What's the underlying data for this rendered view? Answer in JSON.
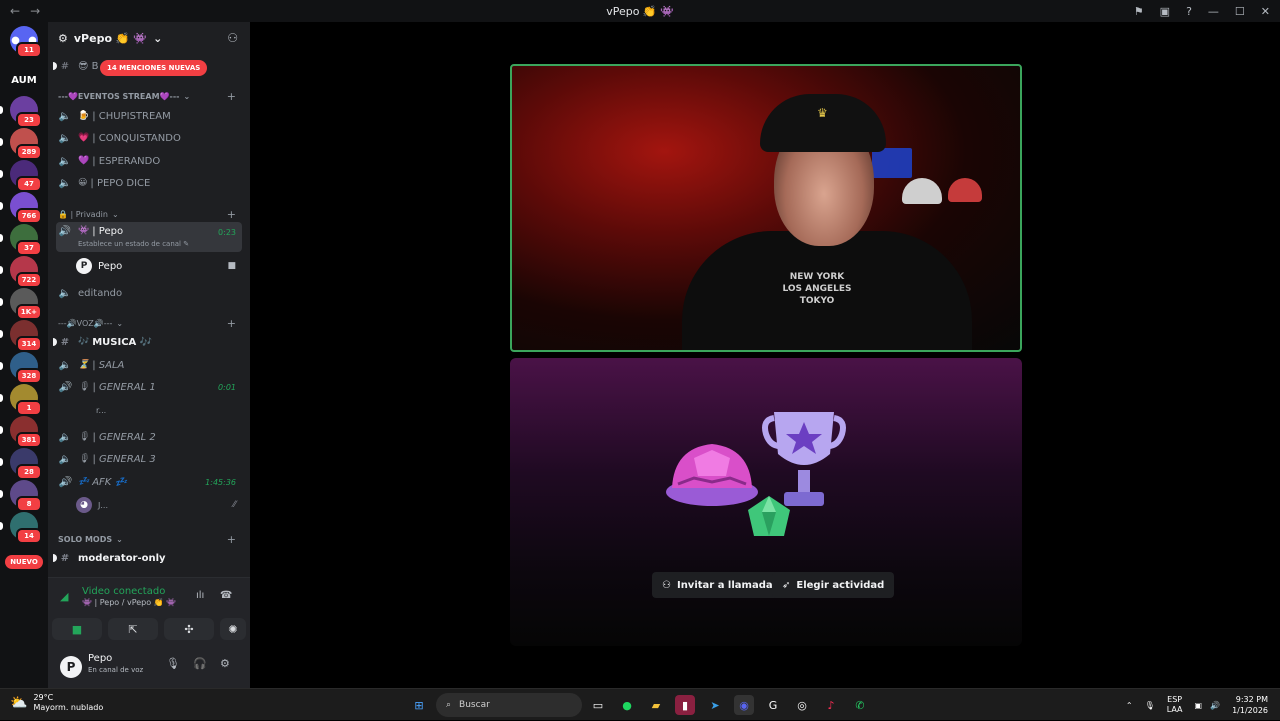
{
  "window": {
    "title": "vPepo 👏 👾",
    "back": "←",
    "forward": "→"
  },
  "rail": {
    "home_badge": "11",
    "aum_label": "AUM",
    "servers": [
      {
        "badge": "23",
        "color": "#6b3fa0"
      },
      {
        "badge": "289",
        "color": "#c0504d"
      },
      {
        "badge": "47",
        "color": "#4b2a7a"
      },
      {
        "badge": "766",
        "color": "#7a4fd1"
      },
      {
        "badge": "37",
        "color": "#3d6e3d"
      },
      {
        "badge": "722",
        "color": "#b5374a"
      },
      {
        "badge": "1K+",
        "color": "#5a5a5a"
      },
      {
        "badge": "314",
        "color": "#7b2f2f"
      },
      {
        "badge": "328",
        "color": "#2f5f8a"
      },
      {
        "badge": "1",
        "color": "#a38a2f"
      },
      {
        "badge": "381",
        "color": "#8a2f2f"
      },
      {
        "badge": "28",
        "color": "#3a3a6a"
      },
      {
        "badge": "8",
        "color": "#5e4a8a"
      },
      {
        "badge": "14",
        "color": "#2f6f6f"
      }
    ],
    "nuevo": "NUEVO"
  },
  "server": {
    "name": "vPepo 👏 👾",
    "mentions": "14 MENCIONES NUEVAS",
    "top_channel_prefix": "😎 B"
  },
  "categories": {
    "eventos": "---💜EVENTOS STREAM💜---",
    "privadin": "🔒 | Privadin",
    "voz": "---🔊VOZ🔊---",
    "solo_mods": "SOLO MODS"
  },
  "channels": {
    "chupistream": {
      "emoji": "🍺",
      "name": "| CHUPISTREAM"
    },
    "conquistando": {
      "emoji": "💗",
      "name": "| CONQUISTANDO"
    },
    "esperando": {
      "emoji": "💜",
      "name": "| ESPERANDO"
    },
    "pepo_dice": {
      "emoji": "😀",
      "name": "| PEPO DICE"
    },
    "pepo": {
      "emoji": "👾",
      "name": "| Pepo",
      "time": "0:23",
      "status": "Establece un estado de canal ✎"
    },
    "pepo_user": "Pepo",
    "editando": "editando",
    "musica": {
      "emoji": "🎶",
      "name": "MUSICA 🎶"
    },
    "sala": {
      "emoji": "⏳",
      "name": "| SALA"
    },
    "general1": {
      "emoji": "🎙",
      "name": "| GENERAL 1",
      "time": "0:01"
    },
    "general1_user": "r...",
    "general2": {
      "emoji": "🎙",
      "name": "| GENERAL 2"
    },
    "general3": {
      "emoji": "🎙",
      "name": "| GENERAL 3"
    },
    "afk": {
      "emoji": "💤",
      "name": "AFK 💤",
      "time": "1:45:36"
    },
    "afk_user": "J...",
    "moderator_only": "moderator-only"
  },
  "voice_panel": {
    "status": "Video conectado",
    "location": "👾 | Pepo / vPepo 👏 👾"
  },
  "user_panel": {
    "name": "Pepo",
    "status": "En canal de voz",
    "avatar_letter": "P"
  },
  "stage": {
    "shirt_print": "NEW YORK\nLOS ANGELES\nTOKYO",
    "invite_label": "Invitar a llamada",
    "activity_label": "Elegir actividad"
  },
  "taskbar": {
    "temp": "29°C",
    "weather": "Mayorm. nublado",
    "search_placeholder": "Buscar",
    "lang1": "ESP",
    "lang2": "LAA",
    "time": "9:32 PM",
    "date": "1/1/2026"
  },
  "colors": {
    "accent_green": "#23a55a",
    "badge_red": "#f23f43",
    "sidebar_bg": "#1e1f22"
  }
}
